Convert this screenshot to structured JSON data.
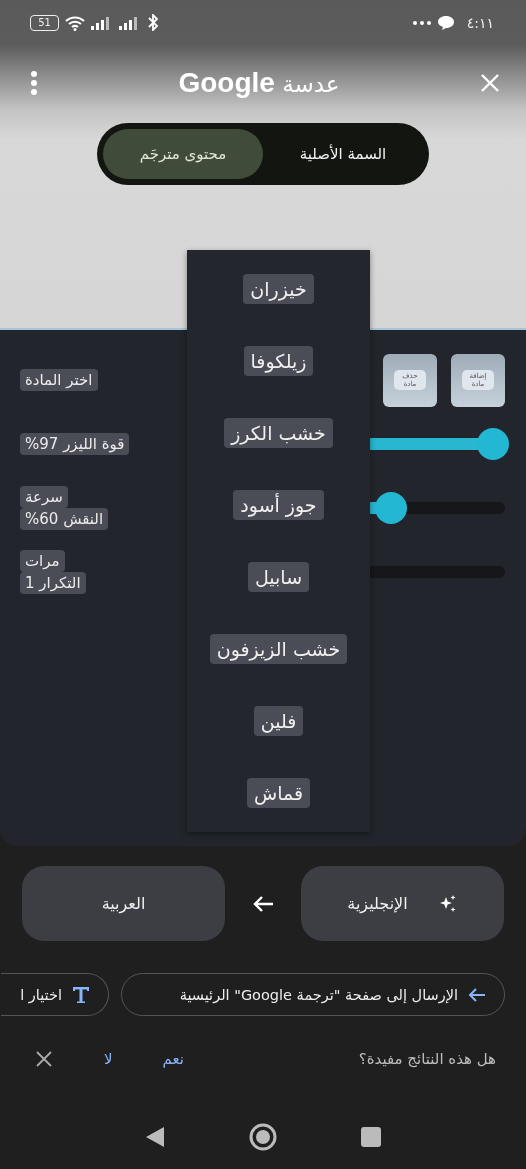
{
  "status_bar": {
    "battery": "51",
    "time": "٤:١١"
  },
  "header": {
    "title": "عدسة **Google**"
  },
  "view_tabs": [
    {
      "label": "السمة الأصلية",
      "selected": false
    },
    {
      "label": "محتوى مترجَم",
      "selected": true
    }
  ],
  "image": {
    "thumbnails": [
      {
        "label": "إضافة مادة"
      },
      {
        "label": "حذف مادة"
      }
    ],
    "rows": [
      {
        "lines": [
          "اختر المادة"
        ],
        "kind": "thumbs"
      },
      {
        "lines": [
          "قوة الليزر 97%"
        ],
        "kind": "slider",
        "level": 0.96
      },
      {
        "lines": [
          "سرعة",
          "النقش 60%"
        ],
        "kind": "slider",
        "level": 0.62
      },
      {
        "lines": [
          "مرات",
          "التكرار 1"
        ],
        "kind": "track"
      }
    ],
    "dropdown": [
      "خيزران",
      "زيلكوفا",
      "خشب الكرز",
      "جوز أسود",
      "سابيل",
      "خشب الزيزفون",
      "فلين",
      "قماش"
    ]
  },
  "languages": {
    "target": "العربية",
    "source": "الإنجليزية"
  },
  "chips": [
    {
      "label": "الإرسال إلى صفحة \"ترجمة Google\" الرئيسية",
      "kind": "send"
    },
    {
      "label": "اختيار ا",
      "kind": "text"
    }
  ],
  "feedback": {
    "question": "هل هذه النتائج مفيدة؟",
    "yes": "نعم",
    "no": "لا"
  }
}
